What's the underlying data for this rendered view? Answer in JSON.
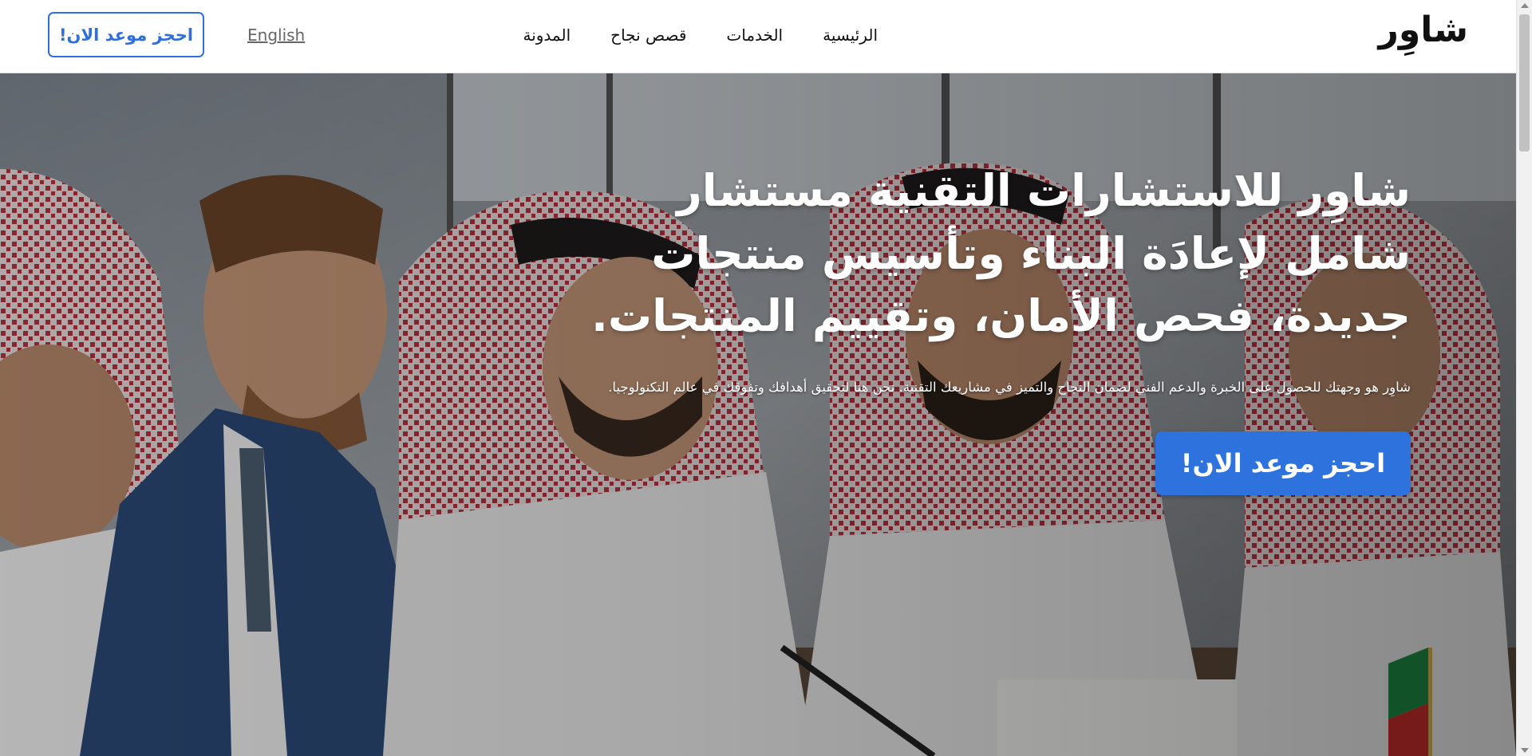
{
  "header": {
    "logo": "شاوِر",
    "nav": [
      "الرئيسية",
      "الخدمات",
      "قصص نجاح",
      "المدونة"
    ],
    "lang_link": "English",
    "cta": "احجز موعد الان!"
  },
  "hero": {
    "title": "شاوِر للاستشارات التقنية مستشار شامل لإعادَة البناء وتأسيس منتجات جديدة، فحص الأمان، وتقييم المنتجات.",
    "subtitle": "شاوِر هو وجهتك للحصول على الخبرة والدعم الفني لضمان النجاح والتميز في مشاريعك التقنية. نحن هنا لتحقيق أهدافك وتفوقك في عالم التكنولوجيا.",
    "cta": "احجز موعد الان!"
  },
  "colors": {
    "accent": "#2e73dd",
    "nav_text": "#111111"
  }
}
